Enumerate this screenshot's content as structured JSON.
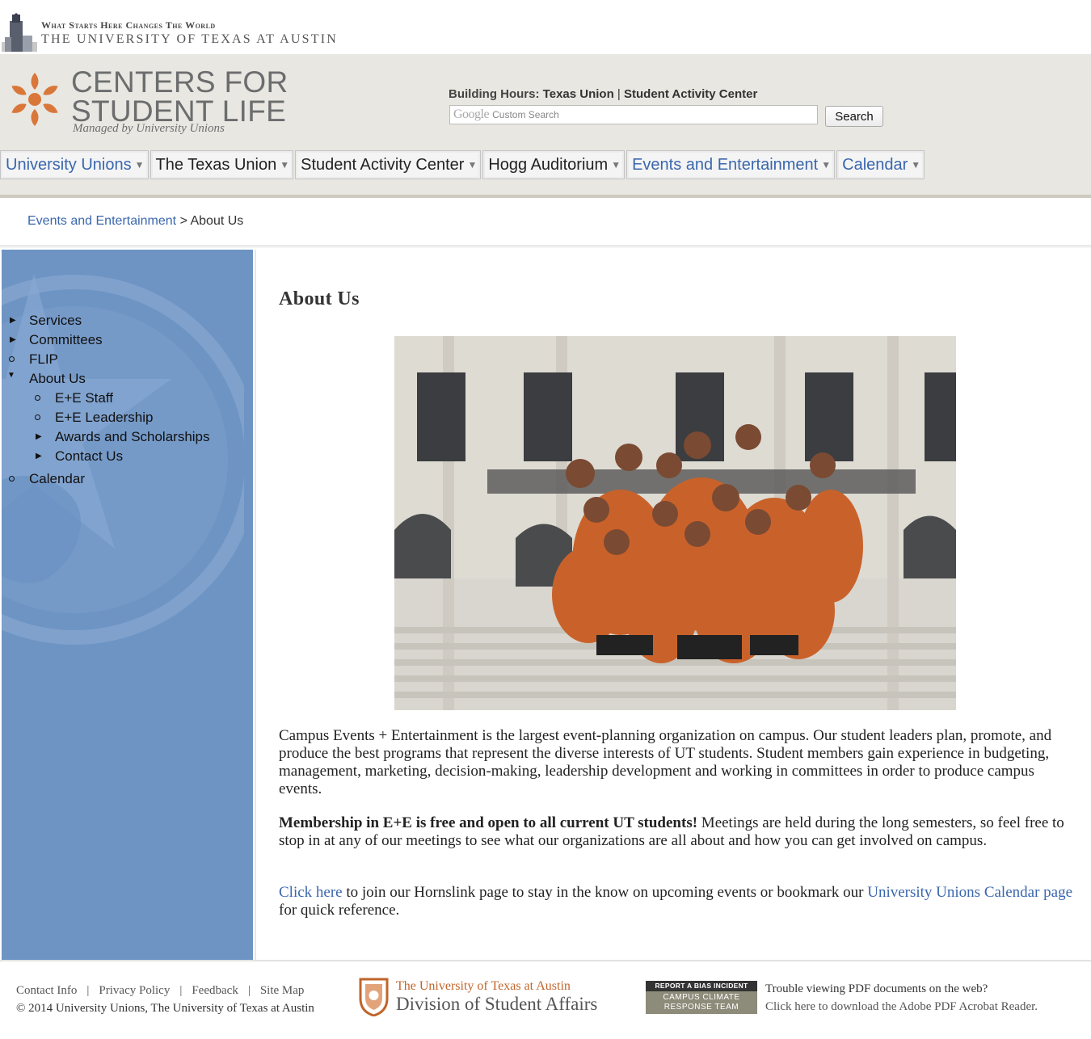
{
  "ut_header": {
    "tagline": "What Starts Here Changes The World",
    "university": "THE UNIVERSITY OF TEXAS AT AUSTIN"
  },
  "brand": {
    "title_line1": "CENTERS FOR",
    "title_line2": "STUDENT LIFE",
    "subtitle": "Managed by University Unions",
    "logo_color": "#d9773a"
  },
  "building_hours": {
    "label": "Building Hours:",
    "link1": "Texas Union",
    "separator": "|",
    "link2": "Student Activity Center"
  },
  "search": {
    "google_mark": "Google",
    "placeholder": "Custom Search",
    "button": "Search"
  },
  "nav": [
    {
      "label": "University Unions"
    },
    {
      "label": "The Texas Union"
    },
    {
      "label": "Student Activity Center"
    },
    {
      "label": "Hogg Auditorium"
    },
    {
      "label": "Events and Entertainment"
    },
    {
      "label": "Calendar"
    }
  ],
  "breadcrumb": {
    "parent": "Events and Entertainment",
    "separator": ">",
    "current": "About Us"
  },
  "sidebar": {
    "items": [
      {
        "label": "Services"
      },
      {
        "label": "Committees"
      },
      {
        "label": "FLIP"
      },
      {
        "label": "About Us"
      },
      {
        "label": "E+E Staff"
      },
      {
        "label": "E+E Leadership"
      },
      {
        "label": "Awards and Scholarships"
      },
      {
        "label": "Contact Us"
      },
      {
        "label": "Calendar"
      }
    ]
  },
  "main": {
    "title": "About Us",
    "p1": "Campus Events + Entertainment is the largest event-planning organization on campus.  Our student leaders plan, promote, and produce the best programs that represent the diverse interests of UT students.  Student members gain experience in budgeting, management, marketing, decision-making, leadership development and working in committees in order to produce campus events.",
    "p2_bold": "Membership in E+E is free and open to all current UT students!",
    "p2_rest": "  Meetings are held during the long semesters, so feel free to stop in at any of our meetings to see what our organizations are all about and how you can get involved on campus.",
    "p3_link1": "Click here",
    "p3_mid": " to join our Hornslink page to stay in the know on upcoming events or bookmark our ",
    "p3_link2": "University Unions Calendar page",
    "p3_end": " for quick reference."
  },
  "footer": {
    "links": [
      "Contact Info",
      "Privacy Policy",
      "Feedback",
      "Site Map"
    ],
    "copyright": "© 2014 University Unions, The University of Texas at Austin",
    "dsa_ut": "The University of Texas at Austin",
    "dsa_name": "Division of Student Affairs",
    "bias_top": "REPORT A BIAS INCIDENT",
    "bias_line1": "CAMPUS CLIMATE",
    "bias_line2": "RESPONSE TEAM",
    "pdf_question": "Trouble viewing PDF documents on the web?",
    "pdf_link": "Click here to download the Adobe PDF Acrobat Reader."
  },
  "colors": {
    "link_blue": "#3a67ad",
    "burnt_orange": "#c0652b",
    "sidebar_blue": "#6e94c4",
    "header_beige": "#e9e7e1"
  }
}
